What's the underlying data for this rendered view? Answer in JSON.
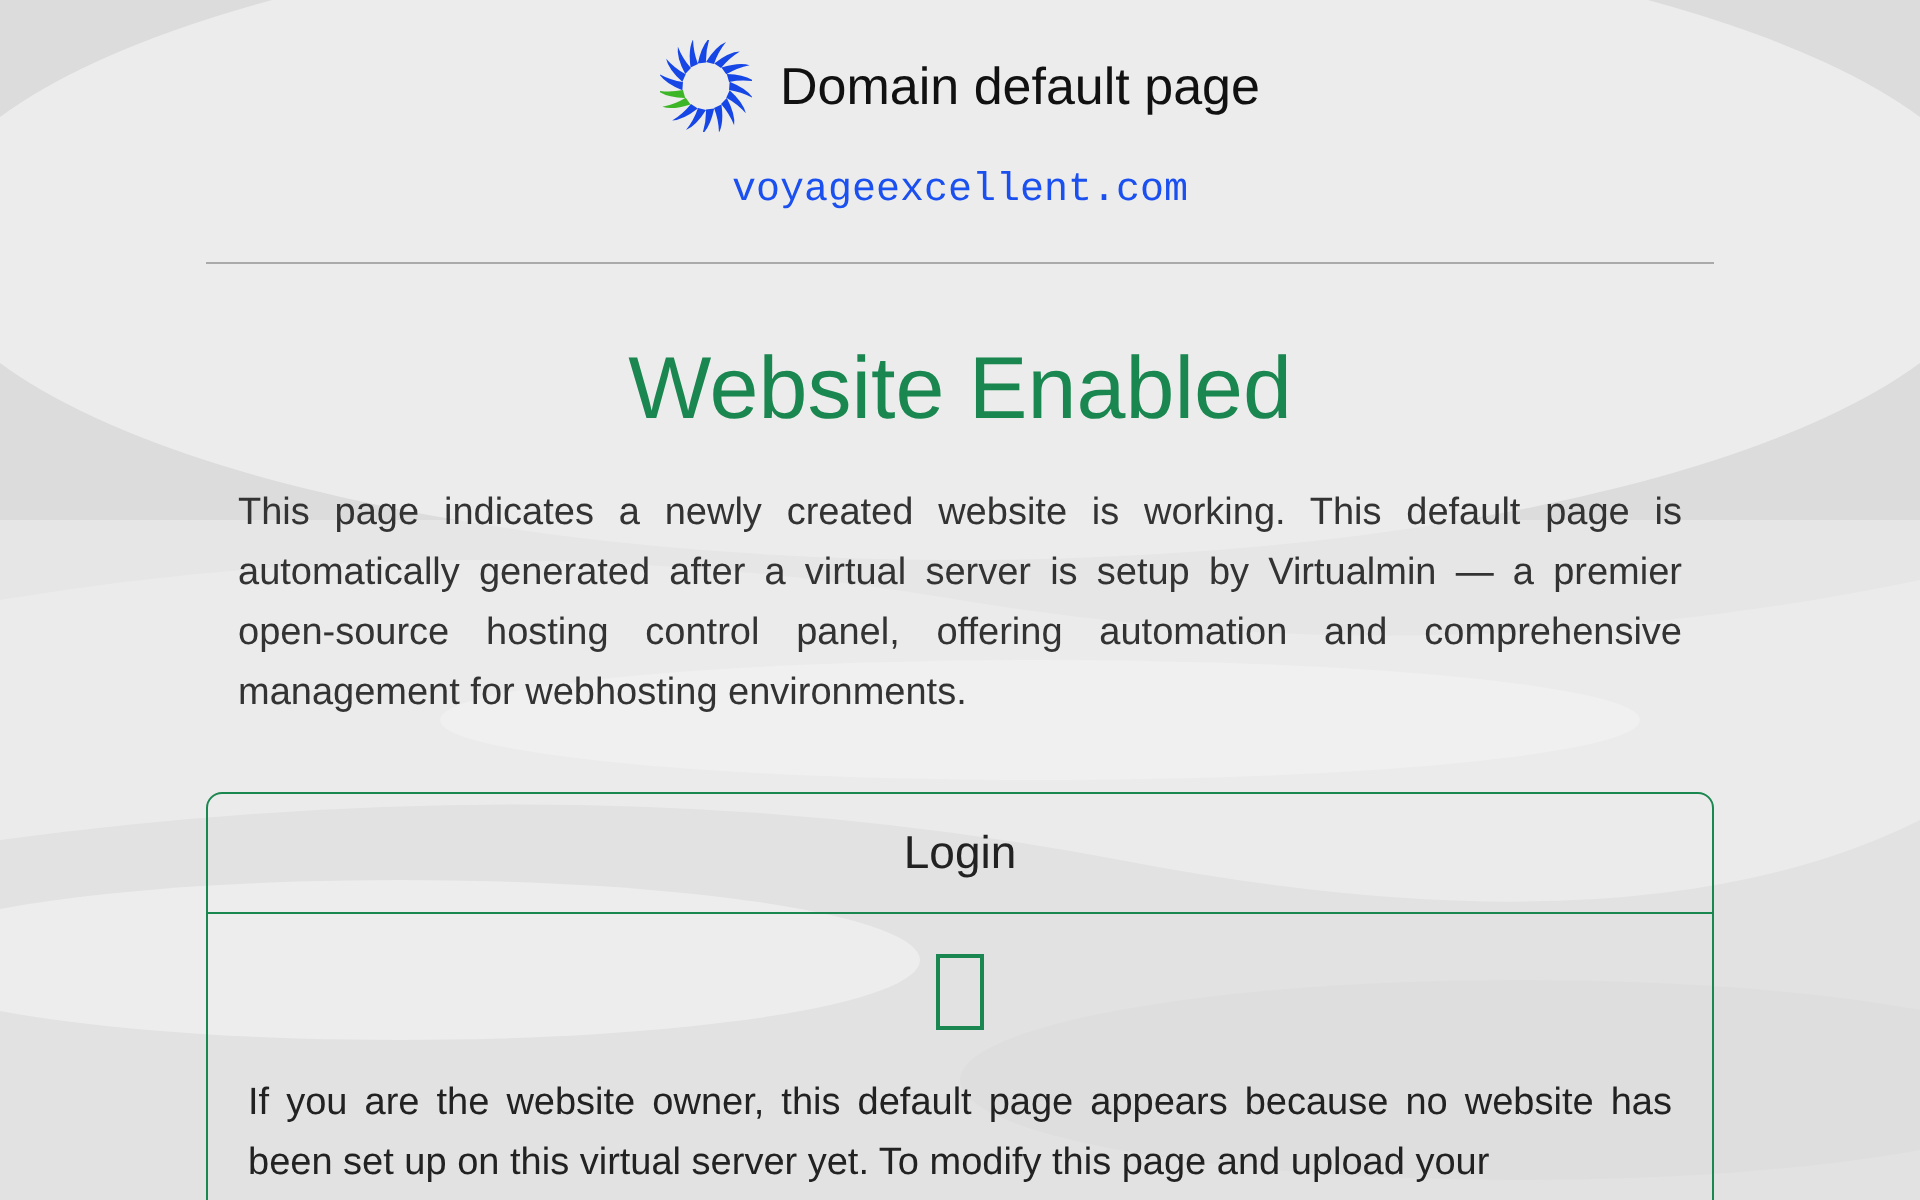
{
  "header": {
    "title": "Domain default page",
    "domain": "voyageexcellent.com"
  },
  "heading": "Website Enabled",
  "intro": "This page indicates a newly created website is working. This default page is automatically generated after a virtual server is setup by Virtualmin — a premier open-source hosting control panel, offering automation and comprehensive management for webhosting environments.",
  "login_card": {
    "title": "Login",
    "text": "If you are the website owner, this default page appears because no website has been set up on this virtual server yet. To modify this page and upload your"
  }
}
